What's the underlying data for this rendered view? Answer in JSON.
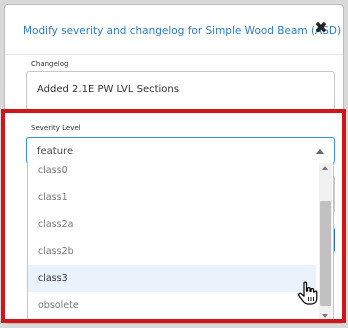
{
  "dialog": {
    "title": "Modify severity and changelog for Simple Wood Beam (ASD)",
    "close_icon": "close-icon"
  },
  "changelog": {
    "label": "Changelog",
    "value": "Added 2.1E PW LVL Sections"
  },
  "severity": {
    "label": "Severity Level",
    "value": "feature",
    "options": [
      {
        "label": "class0"
      },
      {
        "label": "class1"
      },
      {
        "label": "class2a"
      },
      {
        "label": "class2b"
      },
      {
        "label": "class3",
        "highlighted": true
      },
      {
        "label": "obsolete"
      }
    ]
  },
  "colors": {
    "title": "#2e7bc4",
    "highlight_frame": "#d0151b",
    "focus_border": "#3b8fd6"
  }
}
